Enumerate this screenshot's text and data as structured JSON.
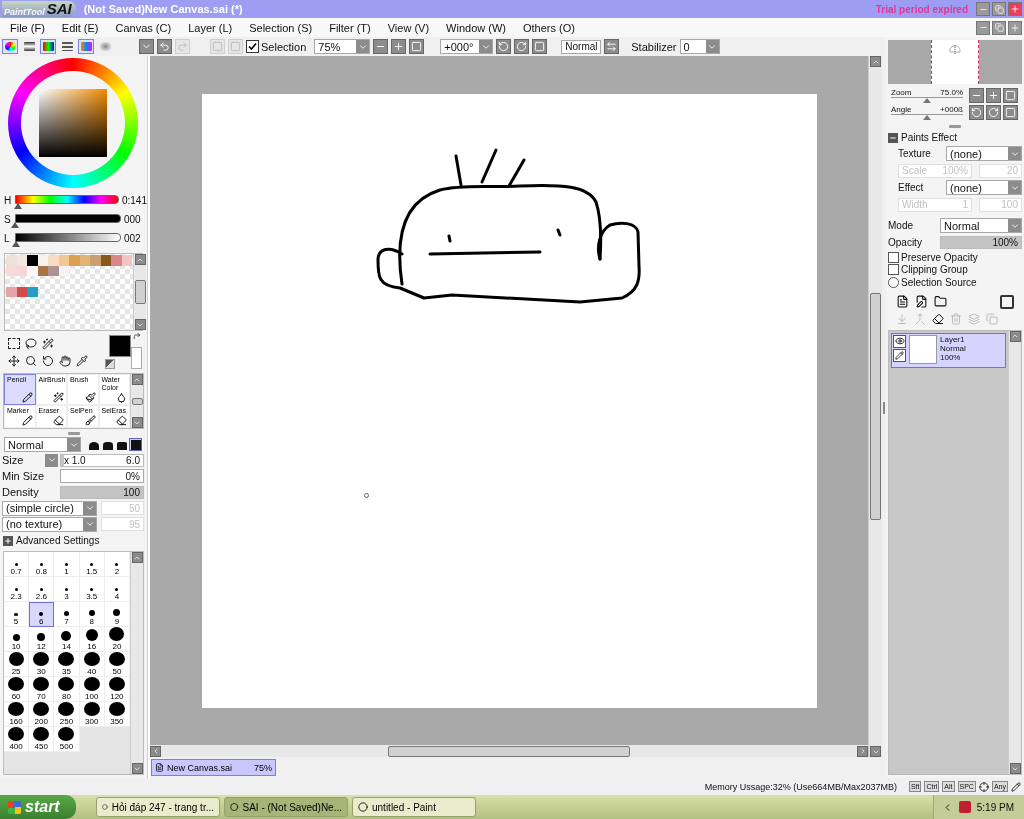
{
  "title_bar": {
    "logo_small": "PaintTool",
    "logo_big": "SAI",
    "title": "(Not Saved)New Canvas.sai (*)",
    "notice": "Trial period expired"
  },
  "menu": [
    "File (F)",
    "Edit (E)",
    "Canvas (C)",
    "Layer (L)",
    "Selection (S)",
    "Filter (T)",
    "View (V)",
    "Window (W)",
    "Others (O)"
  ],
  "color_modes": [
    {
      "selected": true
    },
    {
      "selected": false
    },
    {
      "selected": true
    },
    {
      "selected": false
    },
    {
      "selected": true
    },
    {
      "selected": false
    }
  ],
  "toolbar": {
    "selection": {
      "label": "Selection",
      "checked": true
    },
    "zoom": "75%",
    "angle": "+000°",
    "view_mode": "Normal",
    "stabilizer_label": "Stabilizer",
    "stabilizer": "0"
  },
  "hsl": [
    {
      "label": "H",
      "level": 0.03,
      "reading": "0:141"
    },
    {
      "label": "S",
      "level": 0,
      "reading": "000"
    },
    {
      "label": "L",
      "level": 0.01,
      "reading": "002"
    }
  ],
  "swatch_rows": [
    [
      {
        "color": "#eee0da"
      },
      {
        "color": "#f0e6e2"
      },
      {
        "color": "#000000"
      },
      {
        "color": "#f8f2ee"
      },
      {
        "color": "#f6dcc0"
      },
      {
        "color": "#f0c890"
      },
      {
        "color": "#d8a050"
      },
      {
        "color": "#e2b474"
      },
      {
        "color": "#caa070"
      },
      {
        "color": "#8a5818"
      },
      {
        "color": "#d88888"
      },
      {
        "color": "#f2c4c4"
      }
    ],
    [
      {
        "color": "#f8dada"
      },
      {
        "color": "#f6d6d6"
      },
      {
        "color": "#fbf8f8"
      },
      {
        "color": "#a87444"
      },
      {
        "color": "#ac9494"
      },
      {
        "color": "#f8f2f2"
      }
    ],
    [],
    [
      {
        "color": "#e4a4a4"
      },
      {
        "color": "#d04c4c"
      },
      {
        "color": "#20a0c4"
      }
    ]
  ],
  "brush_tools": [
    {
      "label": "Pencil",
      "selected": true
    },
    {
      "label": "AirBrush",
      "selected": false
    },
    {
      "label": "Brush",
      "selected": false
    },
    {
      "label": "Water Color",
      "selected": false
    },
    {
      "label": "Marker",
      "selected": false
    },
    {
      "label": "Eraser",
      "selected": false
    },
    {
      "label": "SelPen",
      "selected": false
    },
    {
      "label": "SelEras",
      "selected": false
    }
  ],
  "brush": {
    "blend": "Normal",
    "shapes": [
      {
        "selected": false
      },
      {
        "selected": false
      },
      {
        "selected": false
      },
      {
        "selected": true
      }
    ],
    "size": {
      "label": "Size",
      "multiplier": "x 1.0",
      "value": "6.0",
      "level": 0.04
    },
    "min_size": {
      "label": "Min Size",
      "value": "0%"
    },
    "density": {
      "label": "Density",
      "value": "100",
      "level": 1
    },
    "shape": {
      "value": "(simple circle)",
      "extra": "50"
    },
    "texture": {
      "value": "(no texture)",
      "extra": "95"
    },
    "advanced": {
      "label": "Advanced Settings",
      "expanded": false
    }
  },
  "brush_sizes": [
    {
      "label": "0.7",
      "selected": false
    },
    {
      "label": "0.8",
      "selected": false
    },
    {
      "label": "1",
      "selected": false
    },
    {
      "label": "1.5",
      "selected": false
    },
    {
      "label": "2",
      "selected": false
    },
    {
      "label": "2.3",
      "selected": false
    },
    {
      "label": "2.6",
      "selected": false
    },
    {
      "label": "3",
      "selected": false
    },
    {
      "label": "3.5",
      "selected": false
    },
    {
      "label": "4",
      "selected": false
    },
    {
      "label": "5",
      "selected": false
    },
    {
      "label": "6",
      "selected": true
    },
    {
      "label": "7",
      "selected": false
    },
    {
      "label": "8",
      "selected": false
    },
    {
      "label": "9",
      "selected": false
    },
    {
      "label": "10",
      "selected": false
    },
    {
      "label": "12",
      "selected": false
    },
    {
      "label": "14",
      "selected": false
    },
    {
      "label": "16",
      "selected": false
    },
    {
      "label": "20",
      "selected": false
    },
    {
      "label": "25",
      "selected": false
    },
    {
      "label": "30",
      "selected": false
    },
    {
      "label": "35",
      "selected": false
    },
    {
      "label": "40",
      "selected": false
    },
    {
      "label": "50",
      "selected": false
    },
    {
      "label": "60",
      "selected": false
    },
    {
      "label": "70",
      "selected": false
    },
    {
      "label": "80",
      "selected": false
    },
    {
      "label": "100",
      "selected": false
    },
    {
      "label": "120",
      "selected": false
    },
    {
      "label": "160",
      "selected": false
    },
    {
      "label": "200",
      "selected": false
    },
    {
      "label": "250",
      "selected": false
    },
    {
      "label": "300",
      "selected": false
    },
    {
      "label": "350",
      "selected": false
    },
    {
      "label": "400",
      "selected": false
    },
    {
      "label": "450",
      "selected": false
    },
    {
      "label": "500",
      "selected": false
    }
  ],
  "view_sliders": [
    {
      "label": "Zoom",
      "reading": "75.0%",
      "level": 0.5
    },
    {
      "label": "Angle",
      "reading": "+000ß",
      "level": 0.5
    }
  ],
  "paints_effect": {
    "title": "Paints Effect",
    "expanded": true,
    "rows": [
      {
        "kind": "select",
        "label": "Texture",
        "value": "(none)"
      },
      {
        "kind": "params",
        "label": "Scale",
        "value": "100%",
        "extra": "20"
      },
      {
        "kind": "select",
        "label": "Effect",
        "value": "(none)"
      },
      {
        "kind": "params",
        "label": "Width",
        "value": "1",
        "extra": "100"
      }
    ]
  },
  "layer_props": {
    "mode_label": "Mode",
    "mode": "Normal",
    "opacity": {
      "label": "Opacity",
      "reading": "100%",
      "level": 1
    }
  },
  "layer_options": [
    {
      "kind": "checkbox",
      "label": "Preserve Opacity",
      "checked": false
    },
    {
      "kind": "checkbox",
      "label": "Clipping Group",
      "checked": false
    },
    {
      "kind": "radio",
      "label": "Selection Source",
      "checked": false
    }
  ],
  "layers": [
    {
      "name": "Layer1",
      "mode": "Normal",
      "opacity": "100%",
      "selected": true,
      "visible": true
    }
  ],
  "documents": [
    {
      "name": "New Canvas.sai",
      "zoom": "75%",
      "selected": true
    }
  ],
  "status": {
    "memory": "Memory Ussage:32% (Use664MB/Max2037MB)",
    "keys": [
      "Sft",
      "Ctrl",
      "Alt",
      "SPC",
      "Any"
    ]
  },
  "taskbar": {
    "start": "start",
    "tasks": [
      {
        "label": "Hỏi đáp 247 - trang tr...",
        "selected": false
      },
      {
        "label": "SAI - (Not Saved)Ne...",
        "selected": true
      },
      {
        "label": "untitled - Paint",
        "selected": false
      }
    ],
    "time": "5:19 PM"
  }
}
